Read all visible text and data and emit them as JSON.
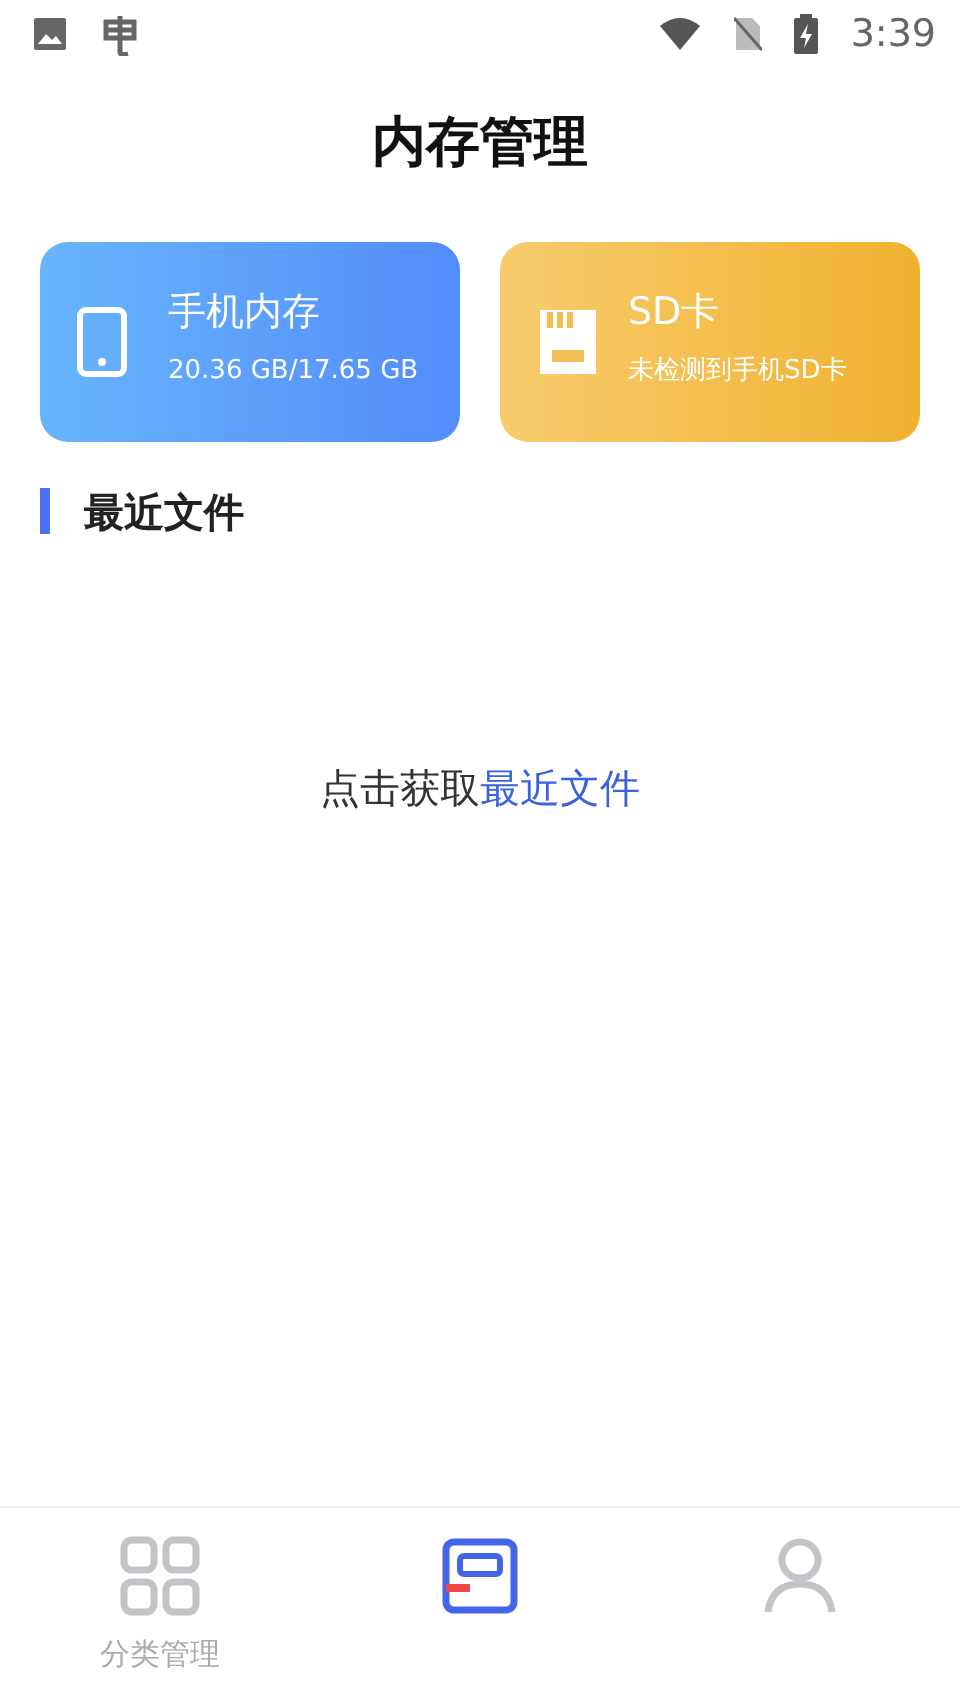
{
  "status_bar": {
    "time": "3:39"
  },
  "title": "内存管理",
  "storage_cards": [
    {
      "kind": "phone",
      "title": "手机内存",
      "detail": "20.36 GB/17.65 GB"
    },
    {
      "kind": "sd",
      "title": "SD卡",
      "detail": "未检测到手机SD卡"
    }
  ],
  "section": {
    "title": "最近文件"
  },
  "empty_prompt": {
    "text": "点击获取",
    "link": "最近文件"
  },
  "bottom_tabs": [
    {
      "kind": "grid",
      "label": "分类管理",
      "selected": false
    },
    {
      "kind": "storage",
      "selected": true
    },
    {
      "kind": "person",
      "selected": false
    }
  ]
}
